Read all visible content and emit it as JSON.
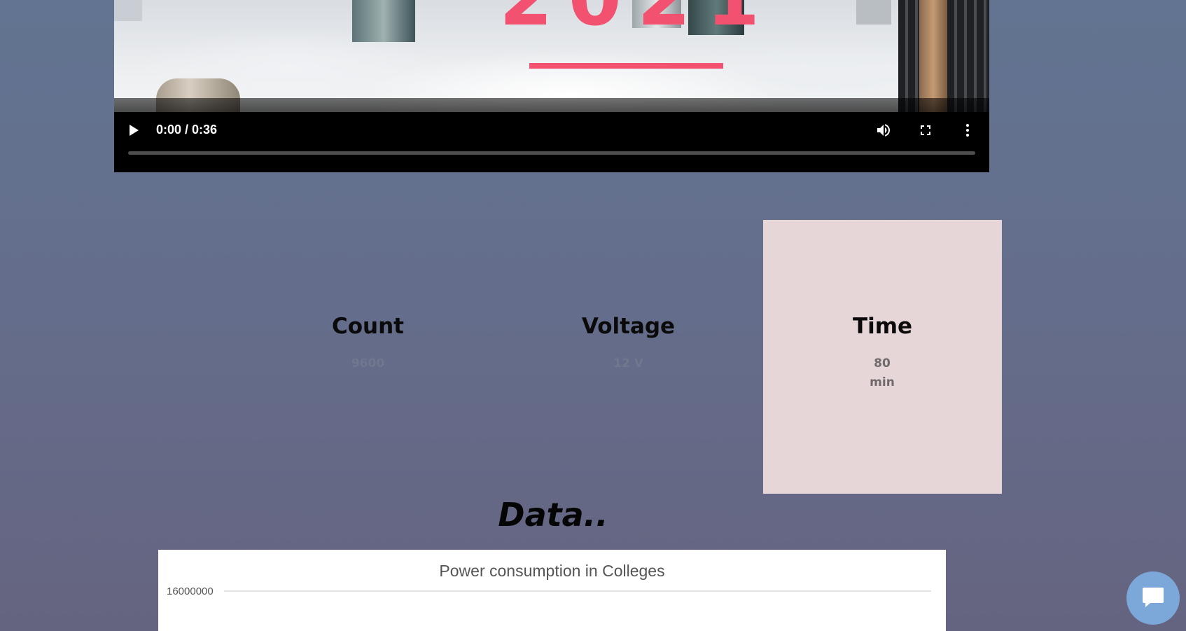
{
  "video": {
    "overlay_text": "2021",
    "time_display": "0:00 / 0:36",
    "progress_fraction": 0
  },
  "stats": [
    {
      "title": "Count",
      "value": "9600"
    },
    {
      "title": "Voltage",
      "value": "12 V"
    },
    {
      "title": "Time",
      "value": "80 min"
    }
  ],
  "data_heading": "Data..",
  "colors": {
    "time_card_bg": "#e6d6d8",
    "video_accent": "#f2526f",
    "chat_button": "#7ba7d9"
  },
  "chart_data": {
    "type": "line",
    "title": "Power consumption in Colleges",
    "y_tick_labels": [
      "16000000"
    ]
  },
  "chat": {
    "icon": "chat-bubble-icon"
  }
}
